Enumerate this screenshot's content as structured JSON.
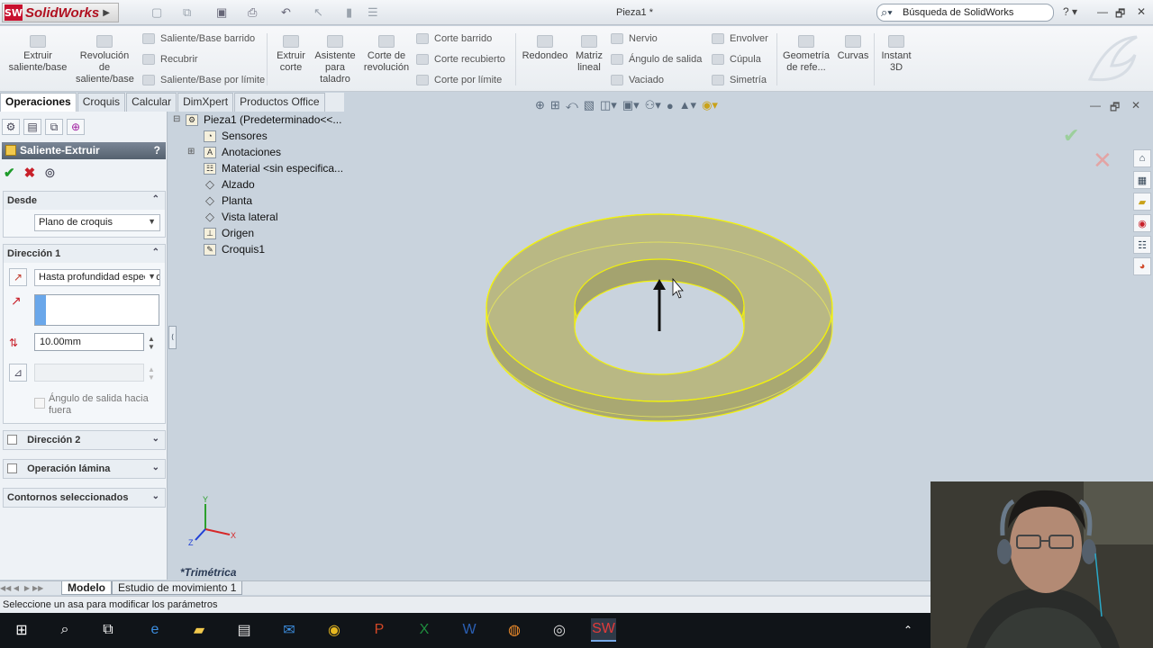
{
  "app": {
    "name": "SolidWorks",
    "logo_badge": "SW",
    "document_title": "Pieza1 *",
    "search_placeholder": "Búsqueda de SolidWorks"
  },
  "ribbon": {
    "features": [
      {
        "label": "Extruir saliente/base",
        "icon": "extrude-boss-icon"
      },
      {
        "label": "Revolución de saliente/base",
        "icon": "revolve-boss-icon"
      },
      {
        "label": "Saliente/Base barrido",
        "icon": "sweep-boss-icon"
      },
      {
        "label": "Recubrir",
        "icon": "loft-icon"
      },
      {
        "label": "Saliente/Base por límite",
        "icon": "boundary-boss-icon"
      },
      {
        "label": "Extruir corte",
        "icon": "extrude-cut-icon"
      },
      {
        "label": "Asistente para taladro",
        "icon": "hole-wizard-icon"
      },
      {
        "label": "Corte de revolución",
        "icon": "revolve-cut-icon"
      },
      {
        "label": "Corte barrido",
        "icon": "sweep-cut-icon"
      },
      {
        "label": "Corte recubierto",
        "icon": "loft-cut-icon"
      },
      {
        "label": "Corte por límite",
        "icon": "boundary-cut-icon"
      },
      {
        "label": "Redondeo",
        "icon": "fillet-icon"
      },
      {
        "label": "Matriz lineal",
        "icon": "linear-pattern-icon"
      },
      {
        "label": "Nervio",
        "icon": "rib-icon"
      },
      {
        "label": "Ángulo de salida",
        "icon": "draft-icon"
      },
      {
        "label": "Vaciado",
        "icon": "shell-icon"
      },
      {
        "label": "Envolver",
        "icon": "wrap-icon"
      },
      {
        "label": "Cúpula",
        "icon": "dome-icon"
      },
      {
        "label": "Simetría",
        "icon": "mirror-icon"
      },
      {
        "label": "Geometría de refe...",
        "icon": "reference-geometry-icon"
      },
      {
        "label": "Curvas",
        "icon": "curves-icon"
      },
      {
        "label": "Instant 3D",
        "icon": "instant3d-icon"
      }
    ]
  },
  "command_tabs": [
    "Operaciones",
    "Croquis",
    "Calcular",
    "DimXpert",
    "Productos Office"
  ],
  "property_manager": {
    "title": "Saliente-Extruir",
    "help": "?",
    "ok_glyph": "✔",
    "cancel_glyph": "✖",
    "from": {
      "header": "Desde",
      "value": "Plano de croquis"
    },
    "direction1": {
      "header": "Dirección 1",
      "end_condition": "Hasta profundidad especificada",
      "depth": "10.00mm",
      "draft_label": "Ángulo de salida hacia fuera"
    },
    "direction2": {
      "header": "Dirección 2"
    },
    "thin_feature": {
      "header": "Operación lámina"
    },
    "selected_contours": {
      "header": "Contornos seleccionados"
    }
  },
  "feature_tree": [
    {
      "label": "Pieza1  (Predeterminado<<...",
      "icon": "part-icon"
    },
    {
      "label": "Sensores",
      "icon": "sensor-icon"
    },
    {
      "label": "Anotaciones",
      "icon": "annotations-icon"
    },
    {
      "label": "Material <sin especifica...",
      "icon": "material-icon"
    },
    {
      "label": "Alzado",
      "icon": "plane-icon"
    },
    {
      "label": "Planta",
      "icon": "plane-icon"
    },
    {
      "label": "Vista lateral",
      "icon": "plane-icon"
    },
    {
      "label": "Origen",
      "icon": "origin-icon"
    },
    {
      "label": "Croquis1",
      "icon": "sketch-icon"
    }
  ],
  "viewport": {
    "view_name": "*Trimétrica",
    "triad": {
      "x": "X",
      "y": "Y",
      "z": "Z"
    },
    "colors": {
      "preview_fill": "#b3b27a",
      "preview_edge": "#f2f20a",
      "background": "#c9d3dd"
    }
  },
  "bottom_tabs": [
    "Modelo",
    "Estudio de movimiento 1"
  ],
  "status_bar": "Seleccione un asa para modificar los parámetros",
  "taskbar": [
    "start",
    "search",
    "task-view",
    "edge",
    "file-explorer",
    "store",
    "mail",
    "chrome",
    "powerpoint",
    "excel",
    "word",
    "firefox",
    "obs",
    "solidworks"
  ]
}
